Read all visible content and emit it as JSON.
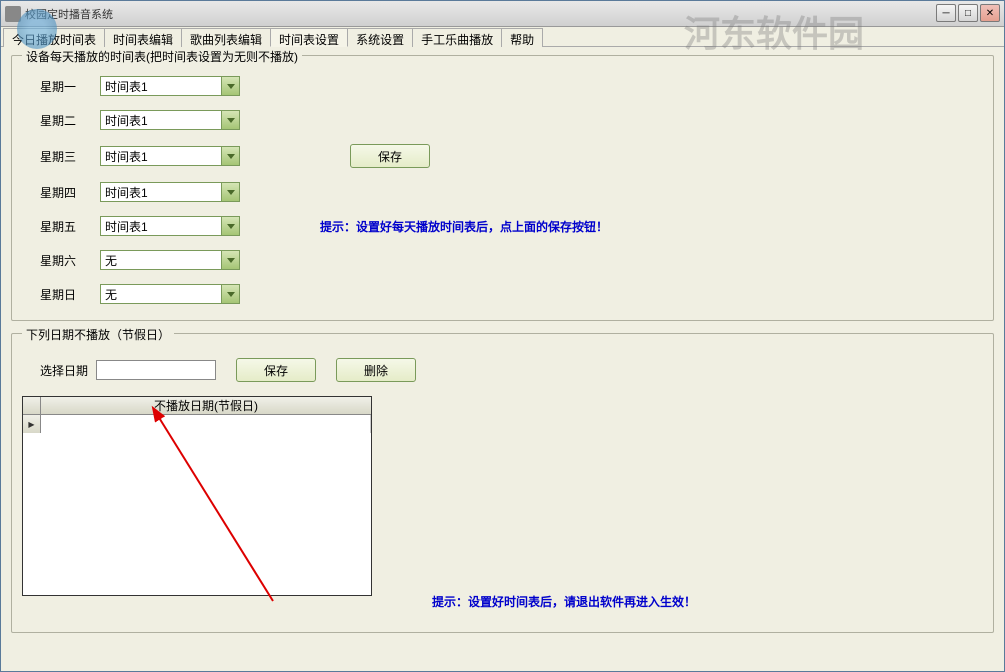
{
  "window": {
    "title": "校园定时播音系统"
  },
  "tabs": {
    "items": [
      {
        "label": "今日播放时间表"
      },
      {
        "label": "时间表编辑"
      },
      {
        "label": "歌曲列表编辑"
      },
      {
        "label": "时间表设置"
      },
      {
        "label": "系统设置"
      },
      {
        "label": "手工乐曲播放"
      },
      {
        "label": "帮助"
      }
    ],
    "activeIndex": 3
  },
  "group1": {
    "title": "设备每天播放的时间表(把时间表设置为无则不播放)",
    "days": [
      {
        "label": "星期一",
        "value": "时间表1"
      },
      {
        "label": "星期二",
        "value": "时间表1"
      },
      {
        "label": "星期三",
        "value": "时间表1"
      },
      {
        "label": "星期四",
        "value": "时间表1"
      },
      {
        "label": "星期五",
        "value": "时间表1"
      },
      {
        "label": "星期六",
        "value": "无"
      },
      {
        "label": "星期日",
        "value": "无"
      }
    ],
    "saveBtn": "保存",
    "hint": "提示：设置好每天播放时间表后，点上面的保存按钮！"
  },
  "group2": {
    "title": "下列日期不播放（节假日）",
    "selectDateLabel": "选择日期",
    "dateValue": "",
    "saveBtn": "保存",
    "deleteBtn": "删除",
    "gridHeader": "不播放日期(节假日)",
    "hint": "提示：设置好时间表后，请退出软件再进入生效！"
  },
  "watermark": "河东软件园"
}
